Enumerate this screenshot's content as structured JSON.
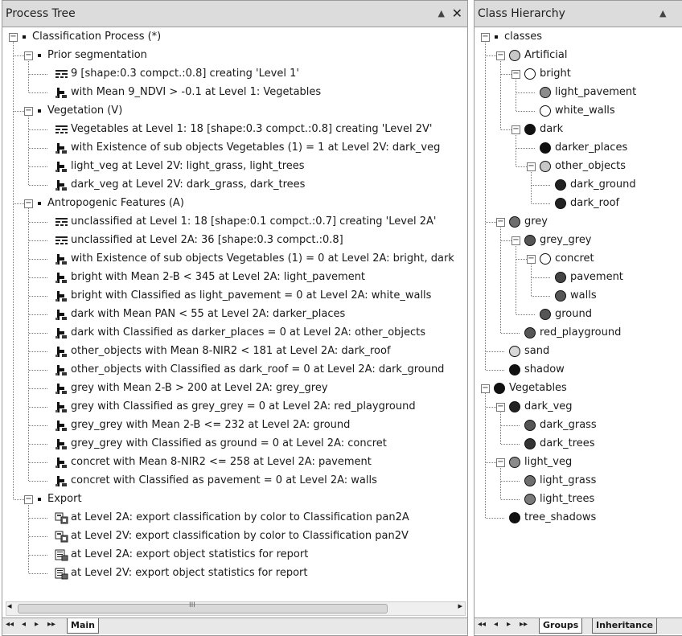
{
  "process_tree": {
    "title": "Process Tree",
    "pin_label": "▲",
    "close_label": "✕",
    "items": [
      {
        "depth": 0,
        "expander": "−",
        "icon": "bullet",
        "label": "Classification Process (*)"
      },
      {
        "depth": 1,
        "expander": "−",
        "icon": "bullet",
        "label": "Prior segmentation"
      },
      {
        "depth": 2,
        "icon": "segmentation",
        "label": "9 [shape:0.3 compct.:0.8] creating 'Level 1'"
      },
      {
        "depth": 2,
        "icon": "classification",
        "label": "with Mean 9_NDVI > -0.1  at Level 1: Vegetables"
      },
      {
        "depth": 1,
        "expander": "−",
        "icon": "bullet",
        "label": "Vegetation (V)"
      },
      {
        "depth": 2,
        "icon": "segmentation",
        "label": "Vegetables at Level 1: 18 [shape:0.3 compct.:0.8] creating 'Level 2V'"
      },
      {
        "depth": 2,
        "icon": "classification",
        "label": "with Existence of sub objects Vegetables (1) = 1  at Level 2V: dark_veg"
      },
      {
        "depth": 2,
        "icon": "classification",
        "label": "light_veg at Level 2V: light_grass, light_trees"
      },
      {
        "depth": 2,
        "icon": "classification",
        "label": "dark_veg at Level 2V: dark_grass, dark_trees"
      },
      {
        "depth": 1,
        "expander": "−",
        "icon": "bullet",
        "label": "Antropogenic Features (A)"
      },
      {
        "depth": 2,
        "icon": "segmentation",
        "label": "unclassified at Level 1: 18 [shape:0.1 compct.:0.7] creating 'Level 2A'"
      },
      {
        "depth": 2,
        "icon": "segmentation",
        "label": "unclassified at Level 2A: 36 [shape:0.3 compct.:0.8]"
      },
      {
        "depth": 2,
        "icon": "classification",
        "label": "with Existence of sub objects Vegetables (1) = 0  at Level 2A: bright, dark"
      },
      {
        "depth": 2,
        "icon": "classification",
        "label": "bright with Mean 2-B < 345  at Level 2A: light_pavement"
      },
      {
        "depth": 2,
        "icon": "classification",
        "label": "bright with Classified as light_pavement = 0  at Level 2A: white_walls"
      },
      {
        "depth": 2,
        "icon": "classification",
        "label": "dark with Mean PAN < 55  at Level 2A: darker_places"
      },
      {
        "depth": 2,
        "icon": "classification",
        "label": "dark with Classified as darker_places = 0  at Level 2A: other_objects"
      },
      {
        "depth": 2,
        "icon": "classification",
        "label": "other_objects with Mean 8-NIR2 < 181  at Level 2A: dark_roof"
      },
      {
        "depth": 2,
        "icon": "classification",
        "label": "other_objects with Classified as dark_roof = 0  at Level 2A: dark_ground"
      },
      {
        "depth": 2,
        "icon": "classification",
        "label": "grey with Mean 2-B > 200  at Level 2A: grey_grey"
      },
      {
        "depth": 2,
        "icon": "classification",
        "label": "grey with Classified as grey_grey = 0  at Level 2A: red_playground"
      },
      {
        "depth": 2,
        "icon": "classification",
        "label": "grey_grey with Mean 2-B <= 232  at Level 2A: ground"
      },
      {
        "depth": 2,
        "icon": "classification",
        "label": "grey_grey with Classified as ground = 0  at Level 2A: concret"
      },
      {
        "depth": 2,
        "icon": "classification",
        "label": "concret with Mean 8-NIR2 <= 258  at Level 2A: pavement"
      },
      {
        "depth": 2,
        "icon": "classification",
        "label": "concret with Classified as pavement = 0  at Level 2A: walls"
      },
      {
        "depth": 1,
        "expander": "−",
        "icon": "bullet",
        "label": "Export"
      },
      {
        "depth": 2,
        "icon": "export",
        "label": "at Level 2A: export classification by color to Classification pan2A"
      },
      {
        "depth": 2,
        "icon": "export",
        "label": "at Level 2V: export classification by color to Classification pan2V"
      },
      {
        "depth": 2,
        "icon": "statistics",
        "label": "at Level 2A: export object statistics for report"
      },
      {
        "depth": 2,
        "icon": "statistics",
        "label": "at Level 2V: export object statistics for report"
      }
    ],
    "scroll_left": "◂",
    "scroll_right": "▸",
    "scroll_grip": "III",
    "nav": [
      "◂◂",
      "◂",
      "▸",
      "▸▸"
    ],
    "tabs": [
      "Main"
    ]
  },
  "class_hierarchy": {
    "title": "Class Hierarchy",
    "pin_label": "▲",
    "close_label": "✕",
    "items": [
      {
        "depth": 0,
        "expander": "−",
        "color": "bullet",
        "label": "classes"
      },
      {
        "depth": 1,
        "expander": "−",
        "color": "#c8c8c8",
        "label": "Artificial"
      },
      {
        "depth": 2,
        "expander": "−",
        "color": "#ffffff",
        "label": "bright"
      },
      {
        "depth": 3,
        "color": "#8c8c8c",
        "label": "light_pavement"
      },
      {
        "depth": 3,
        "color": "#ffffff",
        "label": "white_walls"
      },
      {
        "depth": 2,
        "expander": "−",
        "color": "#111111",
        "label": "dark"
      },
      {
        "depth": 3,
        "color": "#111111",
        "label": "darker_places"
      },
      {
        "depth": 3,
        "expander": "−",
        "color": "#c8c8c8",
        "label": "other_objects"
      },
      {
        "depth": 4,
        "color": "#222222",
        "label": "dark_ground"
      },
      {
        "depth": 4,
        "color": "#222222",
        "label": "dark_roof"
      },
      {
        "depth": 1,
        "expander": "−",
        "color": "#6e6e6e",
        "label": "grey"
      },
      {
        "depth": 2,
        "expander": "−",
        "color": "#555555",
        "label": "grey_grey"
      },
      {
        "depth": 3,
        "expander": "−",
        "color": "#ffffff",
        "label": "concret"
      },
      {
        "depth": 4,
        "color": "#444444",
        "label": "pavement"
      },
      {
        "depth": 4,
        "color": "#555555",
        "label": "walls"
      },
      {
        "depth": 3,
        "color": "#555555",
        "label": "ground"
      },
      {
        "depth": 2,
        "color": "#555555",
        "label": "red_playground"
      },
      {
        "depth": 1,
        "color": "#d8d8d8",
        "label": "sand"
      },
      {
        "depth": 1,
        "color": "#111111",
        "label": "shadow"
      },
      {
        "depth": 0,
        "expander": "−",
        "color": "#111111",
        "label": "Vegetables"
      },
      {
        "depth": 1,
        "expander": "−",
        "color": "#222222",
        "label": "dark_veg"
      },
      {
        "depth": 2,
        "color": "#555555",
        "label": "dark_grass"
      },
      {
        "depth": 2,
        "color": "#333333",
        "label": "dark_trees"
      },
      {
        "depth": 1,
        "expander": "−",
        "color": "#8a8a8a",
        "label": "light_veg"
      },
      {
        "depth": 2,
        "color": "#6e6e6e",
        "label": "light_grass"
      },
      {
        "depth": 2,
        "color": "#7a7a7a",
        "label": "light_trees"
      },
      {
        "depth": 1,
        "color": "#111111",
        "label": "tree_shadows"
      }
    ],
    "nav": [
      "◂◂",
      "◂",
      "▸",
      "▸▸"
    ],
    "tabs": [
      "Groups",
      "Inheritance"
    ]
  }
}
